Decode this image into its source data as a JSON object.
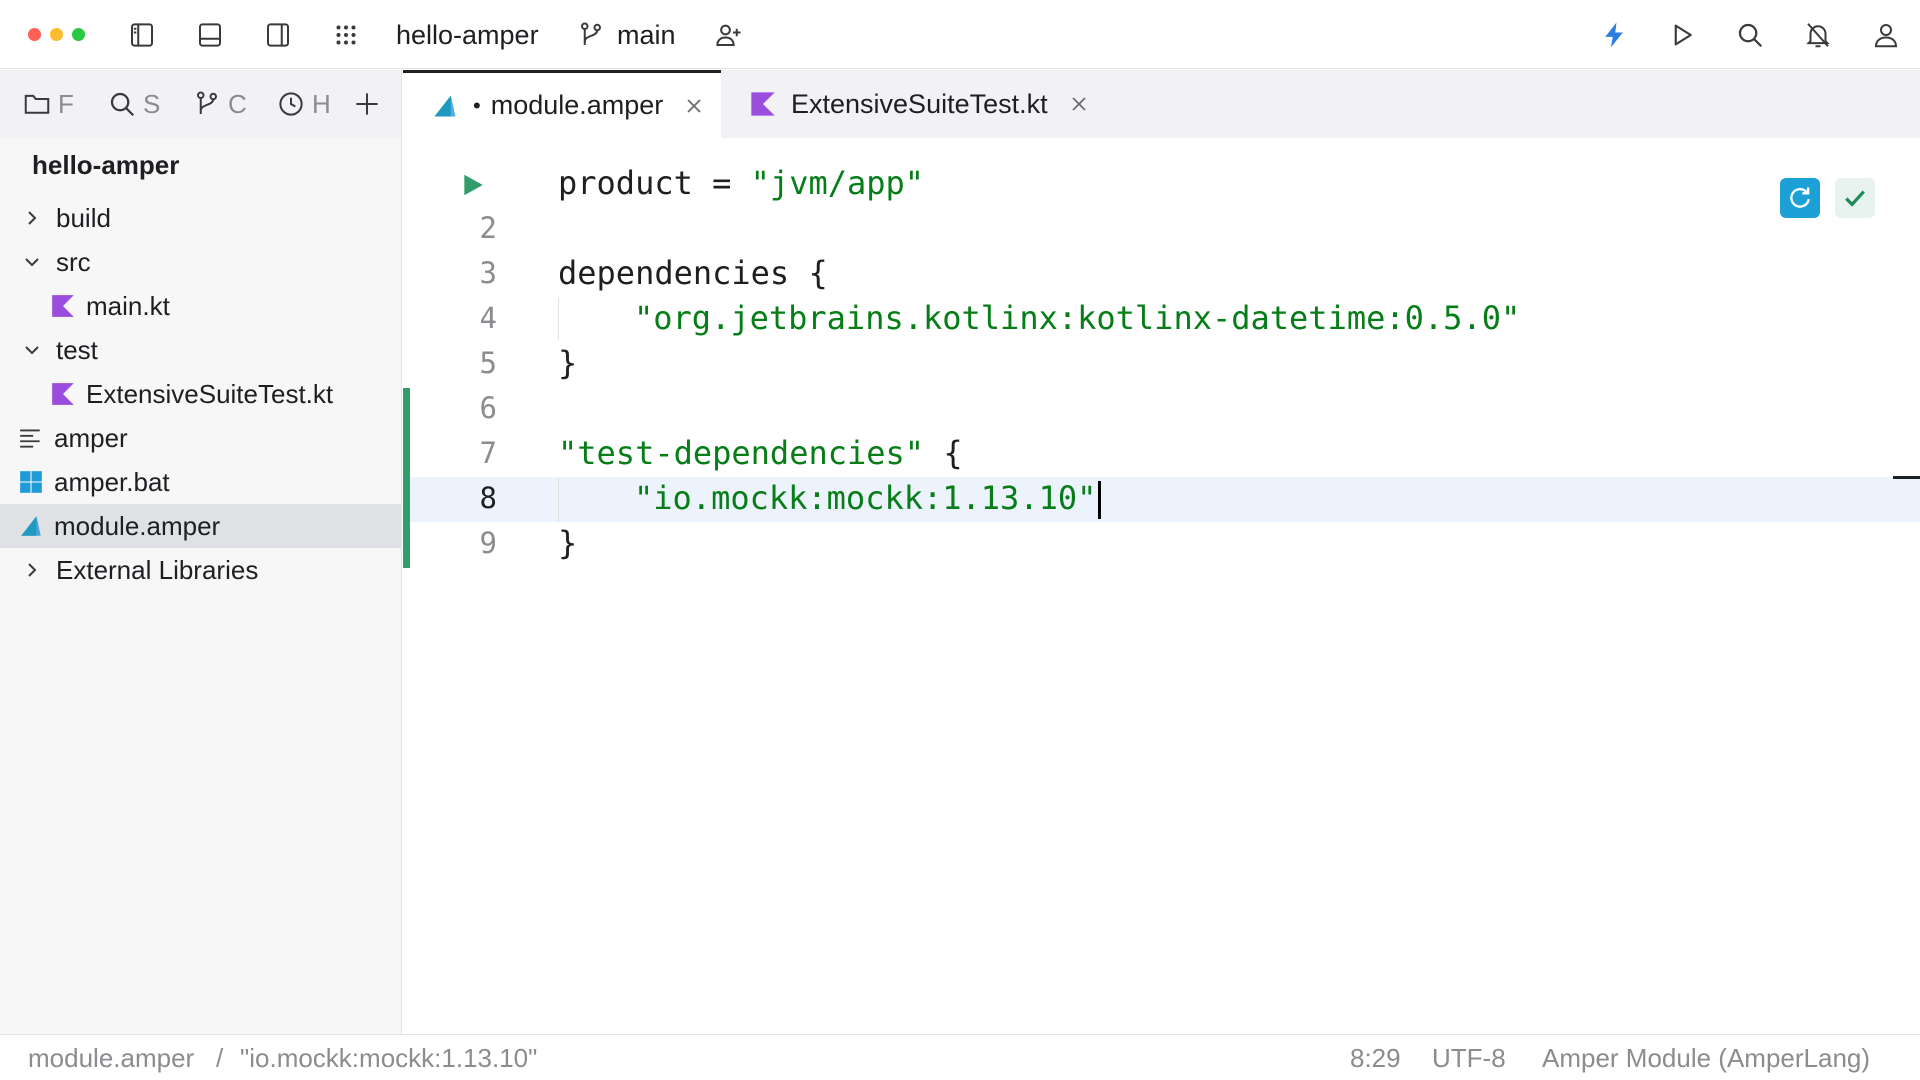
{
  "window": {
    "project_name": "hello-amper",
    "branch": "main",
    "traffic_colors": [
      "#ff5f57",
      "#febc2e",
      "#28c840"
    ]
  },
  "toolbar_right": [
    "bolt-icon",
    "run-icon",
    "search-icon",
    "notifications-off-icon",
    "account-icon"
  ],
  "side_tabs": [
    {
      "icon": "folder-icon",
      "label": "F"
    },
    {
      "icon": "search-icon",
      "label": "S"
    },
    {
      "icon": "git-branch-icon",
      "label": "C"
    },
    {
      "icon": "clock-icon",
      "label": "H"
    }
  ],
  "project_tree": {
    "title": "hello-amper",
    "items": [
      {
        "label": "build",
        "depth": 0,
        "kind": "folder",
        "expanded": false
      },
      {
        "label": "src",
        "depth": 0,
        "kind": "folder",
        "expanded": true
      },
      {
        "label": "main.kt",
        "depth": 1,
        "kind": "kotlin"
      },
      {
        "label": "test",
        "depth": 0,
        "kind": "folder",
        "expanded": true
      },
      {
        "label": "ExtensiveSuiteTest.kt",
        "depth": 1,
        "kind": "kotlin"
      },
      {
        "label": "amper",
        "depth": 0,
        "kind": "text"
      },
      {
        "label": "amper.bat",
        "depth": 0,
        "kind": "windows"
      },
      {
        "label": "module.amper",
        "depth": 0,
        "kind": "amper",
        "selected": true
      },
      {
        "label": "External Libraries",
        "depth": 0,
        "kind": "folder",
        "expanded": false
      }
    ]
  },
  "editor_tabs": [
    {
      "label": "module.amper",
      "active": true,
      "modified": true,
      "modified_mark": "•"
    },
    {
      "label": "ExtensiveSuiteTest.kt",
      "active": false,
      "modified": false
    }
  ],
  "editor": {
    "line_numbers": [
      "2",
      "3",
      "4",
      "5",
      "6",
      "7",
      "8",
      "9"
    ],
    "current_line": "8",
    "code": {
      "l1_key": "product",
      "l1_eq": " = ",
      "l1_val": "\"jvm/app\"",
      "l3": "dependencies {",
      "l4": "\"org.jetbrains.kotlinx:kotlinx-datetime:0.5.0\"",
      "l5": "}",
      "l7_str": "\"test-dependencies\"",
      "l7_brace": " {",
      "l8": "\"io.mockk:mockk:1.13.10\"",
      "l9": "}"
    },
    "string_color": "#067d17",
    "change_marker_color": "#2f9e6b"
  },
  "status": {
    "breadcrumb_file": "module.amper",
    "breadcrumb_sep": "/",
    "breadcrumb_item": "\"io.mockk:mockk:1.13.10\"",
    "position": "8:29",
    "encoding": "UTF-8",
    "file_type": "Amper Module (AmperLang)"
  }
}
